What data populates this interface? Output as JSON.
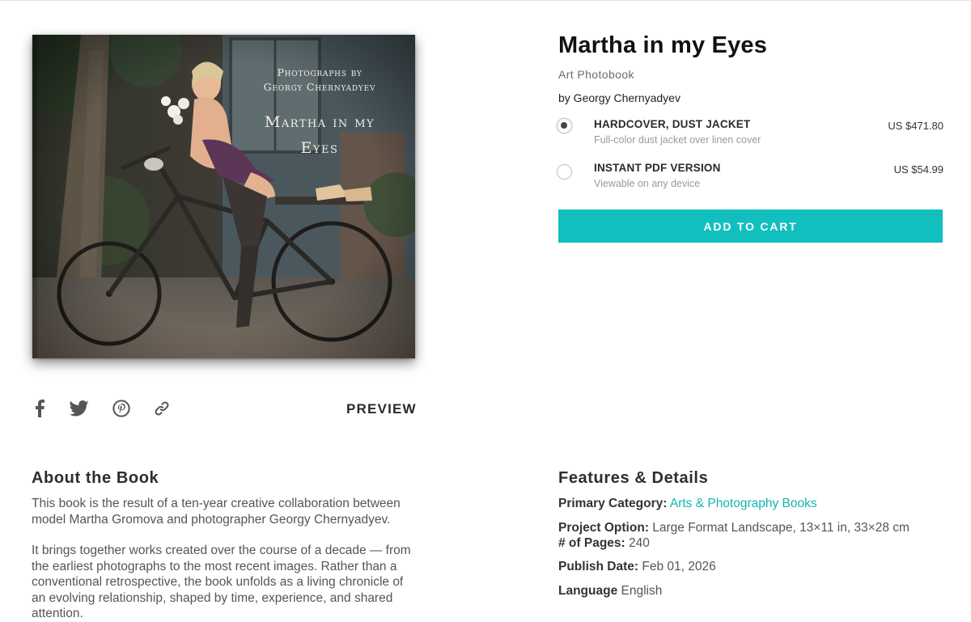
{
  "cover": {
    "subtitle_line1": "Photographs by",
    "subtitle_line2": "Georgy Chernyadyev",
    "title_line1": "Martha in my",
    "title_line2": "Eyes"
  },
  "share": {
    "icons": [
      "facebook-icon",
      "twitter-icon",
      "pinterest-icon",
      "link-icon"
    ],
    "preview_label": "PREVIEW"
  },
  "product": {
    "title": "Martha in my Eyes",
    "category": "Art Photobook",
    "author": "by Georgy Chernyadyev",
    "options": [
      {
        "name": "HARDCOVER, DUST JACKET",
        "description": "Full-color dust jacket over linen cover",
        "price": "US $471.80",
        "selected": true
      },
      {
        "name": "INSTANT PDF VERSION",
        "description": "Viewable on any device",
        "price": "US $54.99",
        "selected": false
      }
    ],
    "add_to_cart_label": "ADD TO CART"
  },
  "about": {
    "heading": "About the Book",
    "paragraph1": "This book is the result of a ten-year creative collaboration between model Martha Gromova and photographer Georgy Chernyadyev.",
    "paragraph2": "It brings together works created over the course of a decade — from the earliest photographs to the most recent images. Rather than a conventional retrospective, the book unfolds as a living chronicle of an evolving relationship, shaped by time, experience, and shared attention."
  },
  "features": {
    "heading": "Features & Details",
    "primary_category_label": "Primary Category:",
    "primary_category_value": "Arts & Photography Books",
    "project_option_label": "Project Option:",
    "project_option_value": "Large Format Landscape, 13×11 in, 33×28 cm",
    "pages_label": "# of Pages:",
    "pages_value": "240",
    "publish_date_label": "Publish Date:",
    "publish_date_value": "Feb 01, 2026",
    "language_label": "Language",
    "language_value": "English"
  },
  "colors": {
    "accent": "#12bfbf",
    "link": "#13b5b5"
  }
}
